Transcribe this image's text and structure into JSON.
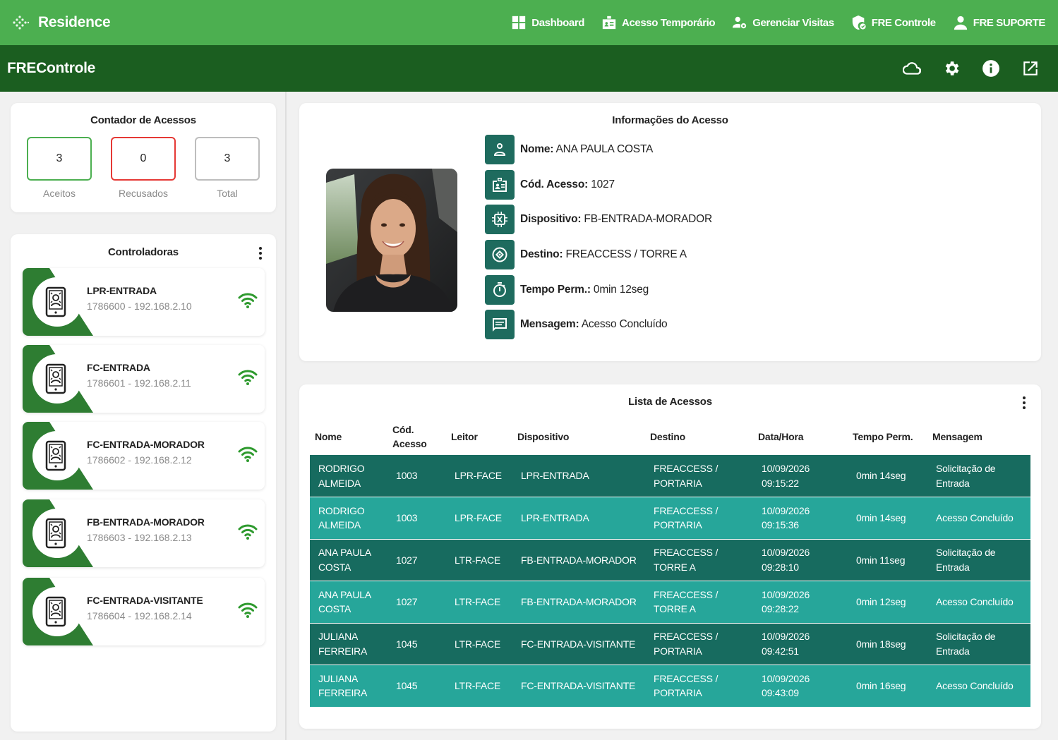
{
  "app": {
    "brand": "Residence"
  },
  "nav": [
    {
      "label": "Dashboard",
      "icon": "dashboard-icon"
    },
    {
      "label": "Acesso Temporário",
      "icon": "badge-icon"
    },
    {
      "label": "Gerenciar Visitas",
      "icon": "user-gear-icon"
    },
    {
      "label": "FRE Controle",
      "icon": "shield-check-icon"
    },
    {
      "label": "FRE SUPORTE",
      "icon": "person-icon"
    }
  ],
  "subheader": {
    "title": "FREControle"
  },
  "counter": {
    "title": "Contador de Acessos",
    "accepted": {
      "value": "3",
      "label": "Aceitos"
    },
    "refused": {
      "value": "0",
      "label": "Recusados"
    },
    "total": {
      "value": "3",
      "label": "Total"
    },
    "colors": {
      "accepted": "#4caf50",
      "refused": "#e53935",
      "total": "#bdbdbd"
    }
  },
  "controllers": {
    "title": "Controladoras",
    "items": [
      {
        "name": "LPR-ENTRADA",
        "sub": "1786600 - 192.168.2.10"
      },
      {
        "name": "FC-ENTRADA",
        "sub": "1786601 - 192.168.2.11"
      },
      {
        "name": "FC-ENTRADA-MORADOR",
        "sub": "1786602 - 192.168.2.12"
      },
      {
        "name": "FB-ENTRADA-MORADOR",
        "sub": "1786603 - 192.168.2.13"
      },
      {
        "name": "FC-ENTRADA-VISITANTE",
        "sub": "1786604 - 192.168.2.14"
      }
    ]
  },
  "info": {
    "title": "Informações do Acesso",
    "rows": [
      {
        "label": "Nome:",
        "value": "ANA PAULA COSTA",
        "icon": "person-icon"
      },
      {
        "label": "Cód. Acesso:",
        "value": "1027",
        "icon": "id-card-icon"
      },
      {
        "label": "Dispositivo:",
        "value": "FB-ENTRADA-MORADOR",
        "icon": "chip-icon"
      },
      {
        "label": "Destino:",
        "value": "FREACCESS / TORRE A",
        "icon": "target-icon"
      },
      {
        "label": "Tempo Perm.:",
        "value": "0min 12seg",
        "icon": "timer-icon"
      },
      {
        "label": "Mensagem:",
        "value": "Acesso Concluído",
        "icon": "message-icon"
      }
    ]
  },
  "list": {
    "title": "Lista de Acessos",
    "headers": [
      "Nome",
      "Cód. Acesso",
      "Leitor",
      "Dispositivo",
      "Destino",
      "Data/Hora",
      "Tempo Perm.",
      "Mensagem"
    ],
    "rows": [
      {
        "nome": "RODRIGO ALMEIDA",
        "cod": "1003",
        "leitor": "LPR-FACE",
        "disp": "LPR-ENTRADA",
        "destino": "FREACCESS / PORTARIA",
        "data": "10/09/2026 09:15:22",
        "tempo": "0min 14seg",
        "msg": "Solicitação de Entrada"
      },
      {
        "nome": "RODRIGO ALMEIDA",
        "cod": "1003",
        "leitor": "LPR-FACE",
        "disp": "LPR-ENTRADA",
        "destino": "FREACCESS / PORTARIA",
        "data": "10/09/2026 09:15:36",
        "tempo": "0min 14seg",
        "msg": "Acesso Concluído"
      },
      {
        "nome": "ANA PAULA COSTA",
        "cod": "1027",
        "leitor": "LTR-FACE",
        "disp": "FB-ENTRADA-MORADOR",
        "destino": "FREACCESS / TORRE A",
        "data": "10/09/2026 09:28:10",
        "tempo": "0min 11seg",
        "msg": "Solicitação de Entrada"
      },
      {
        "nome": "ANA PAULA COSTA",
        "cod": "1027",
        "leitor": "LTR-FACE",
        "disp": "FB-ENTRADA-MORADOR",
        "destino": "FREACCESS / TORRE A",
        "data": "10/09/2026 09:28:22",
        "tempo": "0min 12seg",
        "msg": "Acesso Concluído"
      },
      {
        "nome": "JULIANA FERREIRA",
        "cod": "1045",
        "leitor": "LTR-FACE",
        "disp": "FC-ENTRADA-VISITANTE",
        "destino": "FREACCESS / PORTARIA",
        "data": "10/09/2026 09:42:51",
        "tempo": "0min 18seg",
        "msg": "Solicitação de Entrada"
      },
      {
        "nome": "JULIANA FERREIRA",
        "cod": "1045",
        "leitor": "LTR-FACE",
        "disp": "FC-ENTRADA-VISITANTE",
        "destino": "FREACCESS / PORTARIA",
        "data": "10/09/2026 09:43:09",
        "tempo": "0min 16seg",
        "msg": "Acesso Concluído"
      }
    ]
  },
  "colors": {
    "primary": "#4caf50",
    "dark": "#1b5e20",
    "row_dark": "#176b5f",
    "row_light": "#26a69a",
    "icon_bg": "#1e6b5e"
  }
}
